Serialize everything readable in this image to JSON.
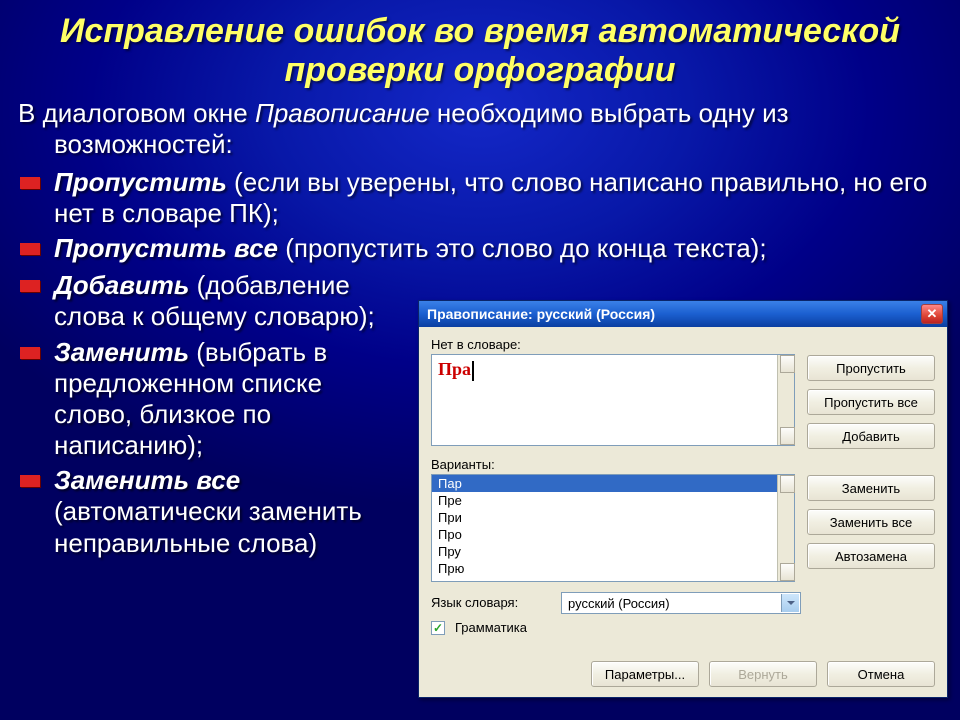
{
  "title": "Исправление ошибок во время автоматической проверки орфографии",
  "intro_prefix": "В диалоговом окне ",
  "intro_ital": "Правописание",
  "intro_suffix": " необходимо выбрать одну из возможностей:",
  "bullets": [
    {
      "term": "Пропустить",
      "rest": " (если вы уверены, что слово написано правильно, но его нет в словаре ПК);"
    },
    {
      "term": "Пропустить все",
      "rest": "  (пропустить это слово до конца текста);"
    },
    {
      "term": "Добавить",
      "rest": "  (добавление слова к общему словарю);"
    },
    {
      "term": "Заменить",
      "rest": "  (выбрать в предложенном списке слово, близкое по написанию);"
    },
    {
      "term": "Заменить все",
      "rest": " (автоматически заменить неправильные слова)"
    }
  ],
  "dialog": {
    "title": "Правописание: русский (Россия)",
    "not_in_dict_label": "Нет в словаре:",
    "misspelled_word": "Пра",
    "variants_label": "Варианты:",
    "variants": [
      "Пар",
      "Пре",
      "При",
      "Про",
      "Пру",
      "Прю"
    ],
    "lang_label": "Язык словаря:",
    "lang_value": "русский (Россия)",
    "grammar_checkbox": "Грамматика",
    "buttons": {
      "skip": "Пропустить",
      "skip_all": "Пропустить все",
      "add": "Добавить",
      "replace": "Заменить",
      "replace_all": "Заменить все",
      "autocorrect": "Автозамена",
      "options": "Параметры...",
      "undo": "Вернуть",
      "cancel": "Отмена"
    }
  }
}
